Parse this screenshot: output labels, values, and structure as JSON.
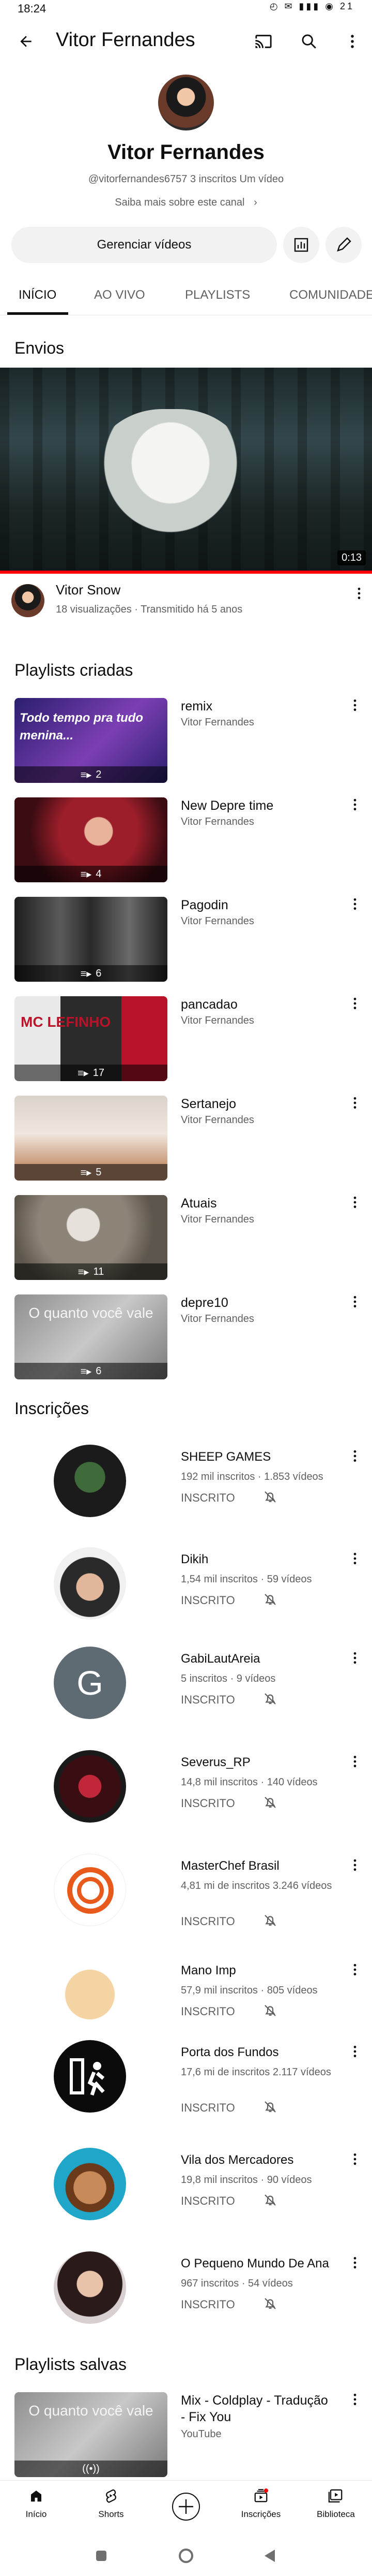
{
  "status_bar": {
    "time": "18:24",
    "icons_text": "◴ ✉ ▮▮▮ ◉ 21"
  },
  "appbar": {
    "title": "Vitor Fernandes"
  },
  "channel": {
    "name": "Vitor Fernandes",
    "meta": "@vitorfernandes6757  3 inscritos  Um vídeo",
    "more": "Saiba mais sobre este canal",
    "manage_label": "Gerenciar vídeos"
  },
  "tabs": [
    "INÍCIO",
    "AO VIVO",
    "PLAYLISTS",
    "COMUNIDADE"
  ],
  "uploads": {
    "section_title": "Envios",
    "video": {
      "duration": "0:13",
      "title": "Vitor Snow",
      "meta": "18 visualizações · Transmitido há 5 anos"
    }
  },
  "playlists": {
    "section_title": "Playlists criadas",
    "items": [
      {
        "title": "remix",
        "owner": "Vitor Fernandes",
        "count": "2",
        "thumb_text": "Todo tempo pra tudo menina..."
      },
      {
        "title": "New Depre time",
        "owner": "Vitor Fernandes",
        "count": "4",
        "thumb_text": ""
      },
      {
        "title": "Pagodin",
        "owner": "Vitor Fernandes",
        "count": "6",
        "thumb_text": ""
      },
      {
        "title": "pancadao",
        "owner": "Vitor Fernandes",
        "count": "17",
        "thumb_text": "MC LEFINHO"
      },
      {
        "title": "Sertanejo",
        "owner": "Vitor Fernandes",
        "count": "5",
        "thumb_text": ""
      },
      {
        "title": "Atuais",
        "owner": "Vitor Fernandes",
        "count": "11",
        "thumb_text": ""
      },
      {
        "title": "depre10",
        "owner": "Vitor Fernandes",
        "count": "6",
        "thumb_text": "O quanto você vale"
      }
    ]
  },
  "subscriptions": {
    "section_title": "Inscrições",
    "button_label": "INSCRITO",
    "items": [
      {
        "name": "SHEEP GAMES",
        "meta": "192 mil inscritos · 1.853 vídeos"
      },
      {
        "name": "Dikih",
        "meta": "1,54 mil inscritos · 59 vídeos"
      },
      {
        "name": "GabiLautAreia",
        "meta": "5 inscritos · 9 vídeos",
        "initial": "G"
      },
      {
        "name": "Severus_RP",
        "meta": "14,8 mil inscritos · 140 vídeos"
      },
      {
        "name": "MasterChef Brasil",
        "meta": "4,81 mi de inscritos 3.246 vídeos"
      },
      {
        "name": "Mano Imp",
        "meta": "57,9 mil inscritos · 805 vídeos"
      },
      {
        "name": "Porta dos Fundos",
        "meta": "17,6 mi de inscritos 2.117 vídeos"
      },
      {
        "name": "Vila dos Mercadores",
        "meta": "19,8 mil inscritos · 90 vídeos"
      },
      {
        "name": "O Pequeno Mundo De Ana",
        "meta": "967 inscritos · 54 vídeos"
      }
    ]
  },
  "saved_playlists": {
    "section_title": "Playlists salvas",
    "items": [
      {
        "title": "Mix - Coldplay - Tradução - Fix You",
        "owner": "YouTube",
        "thumb_text": "O quanto você vale"
      }
    ]
  },
  "bottom_nav": [
    "Início",
    "Shorts",
    "Inscrições",
    "Biblioteca"
  ],
  "colors": {
    "accent_red": "#ff0000",
    "chip_bg": "#f2f2f2",
    "secondary_text": "#606060"
  }
}
